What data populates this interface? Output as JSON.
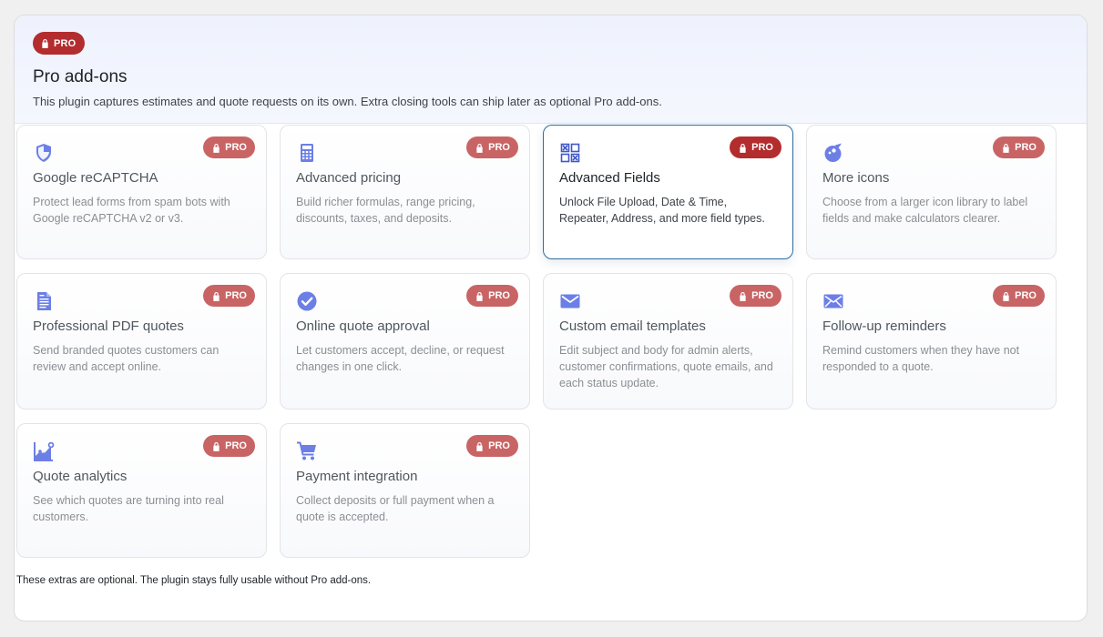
{
  "header": {
    "badge": "PRO",
    "title": "Pro add-ons",
    "description": "This plugin captures estimates and quote requests on its own. Extra closing tools can ship later as optional Pro add-ons."
  },
  "cards": [
    {
      "badge": "PRO",
      "title": "Google reCAPTCHA",
      "description": "Protect lead forms from spam bots with Google reCAPTCHA v2 or v3.",
      "icon": "shield-icon"
    },
    {
      "badge": "PRO",
      "title": "Advanced pricing",
      "description": "Build richer formulas, range pricing, discounts, taxes, and deposits.",
      "icon": "calculator-icon"
    },
    {
      "badge": "PRO",
      "title": "Advanced Fields",
      "description": "Unlock File Upload, Date & Time, Repeater, Address, and more field types.",
      "icon": "fields-grid-icon"
    },
    {
      "badge": "PRO",
      "title": "More icons",
      "description": "Choose from a larger icon library to label fields and make calculators clearer.",
      "icon": "palette-icon"
    },
    {
      "badge": "PRO",
      "title": "Professional PDF quotes",
      "description": "Send branded quotes customers can review and accept online.",
      "icon": "document-icon"
    },
    {
      "badge": "PRO",
      "title": "Online quote approval",
      "description": "Let customers accept, decline, or request changes in one click.",
      "icon": "check-circle-icon"
    },
    {
      "badge": "PRO",
      "title": "Custom email templates",
      "description": "Edit subject and body for admin alerts, customer confirmations, quote emails, and each status update.",
      "icon": "email-icon"
    },
    {
      "badge": "PRO",
      "title": "Follow-up reminders",
      "description": "Remind customers when they have not responded to a quote.",
      "icon": "envelope-icon"
    },
    {
      "badge": "PRO",
      "title": "Quote analytics",
      "description": "See which quotes are turning into real customers.",
      "icon": "analytics-icon"
    },
    {
      "badge": "PRO",
      "title": "Payment integration",
      "description": "Collect deposits or full payment when a quote is accepted.",
      "icon": "cart-icon"
    }
  ],
  "footer": {
    "note": "These extras are optional. The plugin stays fully usable without Pro add-ons."
  },
  "colors": {
    "accent": "#6c7fe6",
    "pro_badge": "#b32d2e",
    "pro_badge_muted": "#c96465",
    "active_border": "#2c6fa3"
  }
}
